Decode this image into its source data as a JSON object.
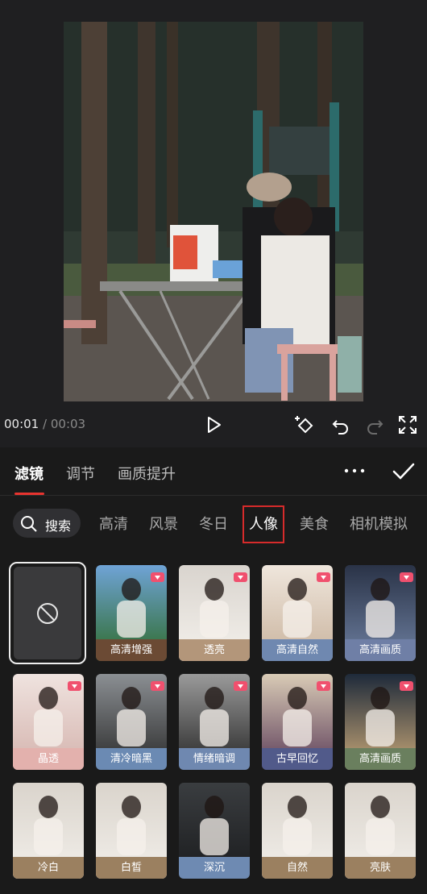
{
  "player": {
    "current_time": "00:01",
    "separator": "/",
    "total_time": "00:03"
  },
  "tabs": [
    {
      "label": "滤镜",
      "active": true
    },
    {
      "label": "调节",
      "active": false
    },
    {
      "label": "画质提升",
      "active": false
    }
  ],
  "categories": {
    "search_label": "搜索",
    "items": [
      "高清",
      "风景",
      "冬日",
      "人像",
      "美食",
      "相机模拟"
    ],
    "active": "人像"
  },
  "filters": [
    {
      "label": "高清增强",
      "label_color": "#6b4a34"
    },
    {
      "label": "透亮",
      "label_color": "#b3967a"
    },
    {
      "label": "高清自然",
      "label_color": "#6f88b0"
    },
    {
      "label": "高清画质",
      "label_color": "#6f7fa6"
    },
    {
      "label": "晶透",
      "label_color": "#e3b1ad"
    },
    {
      "label": "清冷暗黑",
      "label_color": "#6b8ab3"
    },
    {
      "label": "情绪暗调",
      "label_color": "#6f88b0"
    },
    {
      "label": "古早回忆",
      "label_color": "#515a8a"
    },
    {
      "label": "高清画质",
      "label_color": "#6a7f5e"
    },
    {
      "label": "冷白",
      "label_color": "#9b8060"
    },
    {
      "label": "白皙",
      "label_color": "#9b8060"
    },
    {
      "label": "深沉",
      "label_color": "#6e8ab2"
    },
    {
      "label": "自然",
      "label_color": "#9b8060"
    },
    {
      "label": "亮肤",
      "label_color": "#9b8060"
    }
  ],
  "colors": {
    "accent": "#e8342f",
    "vip_badge": "#f0506e"
  }
}
